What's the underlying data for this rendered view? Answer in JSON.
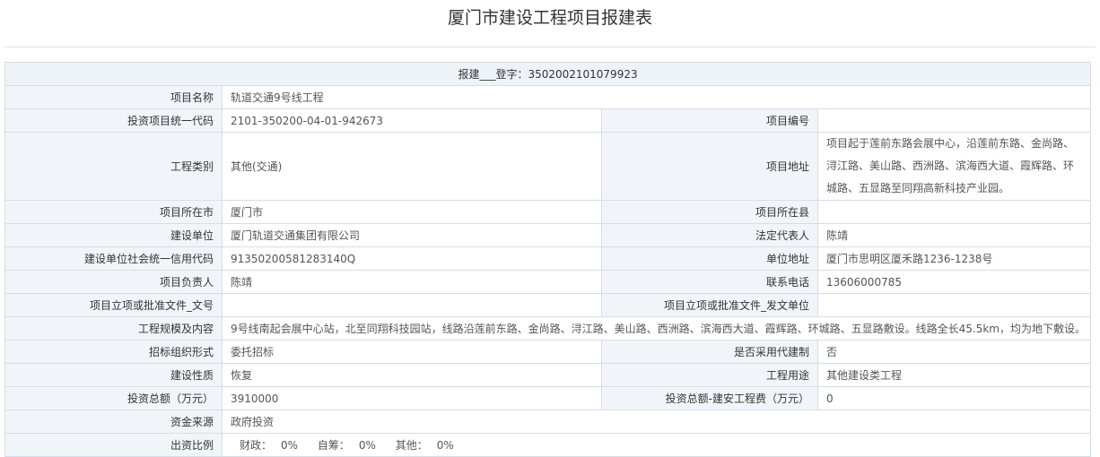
{
  "page": {
    "title": "厦门市建设工程项目报建表",
    "registration": "报建___登字：3502002101079923"
  },
  "fields": {
    "project_name": {
      "label": "项目名称",
      "value": "轨道交通9号线工程"
    },
    "investment_code": {
      "label": "投资项目统一代码",
      "value": "2101-350200-04-01-942673"
    },
    "project_no": {
      "label": "项目编号",
      "value": ""
    },
    "category": {
      "label": "工程类别",
      "value": "其他(交通)"
    },
    "address": {
      "label": "项目地址",
      "value": "项目起于莲前东路会展中心，沿莲前东路、金尚路、浔江路、美山路、西洲路、滨海西大道、霞辉路、环城路、五显路至同翔高新科技产业园。"
    },
    "city": {
      "label": "项目所在市",
      "value": "厦门市"
    },
    "county": {
      "label": "项目所在县",
      "value": ""
    },
    "builder": {
      "label": "建设单位",
      "value": "厦门轨道交通集团有限公司"
    },
    "legal_rep": {
      "label": "法定代表人",
      "value": "陈靖"
    },
    "credit_code": {
      "label": "建设单位社会统一信用代码",
      "value": "91350200581283140Q"
    },
    "unit_address": {
      "label": "单位地址",
      "value": "厦门市思明区厦禾路1236-1238号"
    },
    "manager": {
      "label": "项目负责人",
      "value": "陈靖"
    },
    "phone": {
      "label": "联系电话",
      "value": "13606000785"
    },
    "approval_doc": {
      "label": "项目立项或批准文件_文号",
      "value": ""
    },
    "approval_unit": {
      "label": "项目立项或批准文件_发文单位",
      "value": ""
    },
    "scale": {
      "label": "工程规模及内容",
      "value": "9号线南起会展中心站，北至同翔科技园站，线路沿莲前东路、金尚路、浔江路、美山路、西洲路、滨海西大道、霞辉路、环城路、五显路敷设。线路全长45.5km，均为地下敷设。"
    },
    "tender_form": {
      "label": "招标组织形式",
      "value": "委托招标"
    },
    "agent_build": {
      "label": "是否采用代建制",
      "value": "否"
    },
    "nature": {
      "label": "建设性质",
      "value": "恢复"
    },
    "usage": {
      "label": "工程用途",
      "value": "其他建设类工程"
    },
    "total_invest": {
      "label": "投资总额（万元）",
      "value": "3910000"
    },
    "install_cost": {
      "label": "投资总额-建安工程费（万元）",
      "value": "0"
    },
    "fund_source": {
      "label": "资金来源",
      "value": "政府投资"
    },
    "ratio": {
      "label": "出资比例",
      "items": [
        {
          "label": "财政：",
          "value": "0%"
        },
        {
          "label": "自筹：",
          "value": "0%"
        },
        {
          "label": "其他：",
          "value": "0%"
        }
      ]
    }
  }
}
